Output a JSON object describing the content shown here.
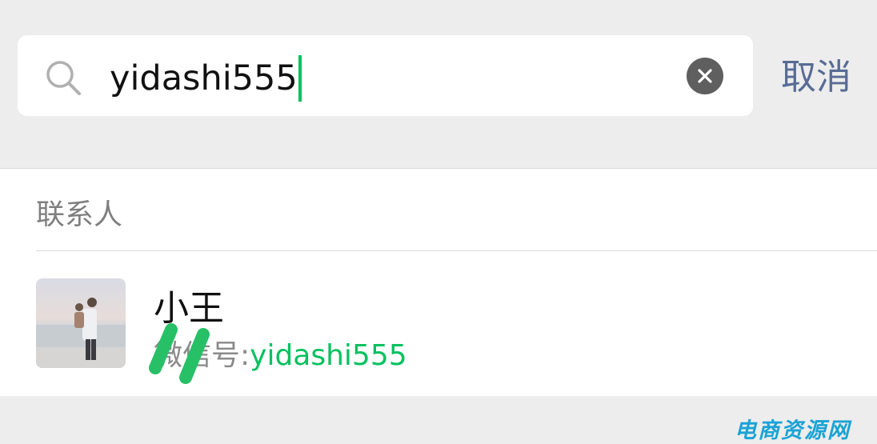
{
  "search": {
    "query": "yidashi555",
    "cancel_label": "取消",
    "icon": "search-icon",
    "clear_icon": "clear-icon"
  },
  "results": {
    "section_label": "联系人",
    "contacts": [
      {
        "name": "小王",
        "sub_prefix": "微信号:",
        "sub_match": "yidashi555",
        "avatar": "beach-photo-avatar"
      }
    ]
  },
  "watermark": "电商资源网",
  "colors": {
    "accent": "#07c160",
    "cancel": "#576b95",
    "background": "#ededed",
    "panel": "#ffffff"
  }
}
